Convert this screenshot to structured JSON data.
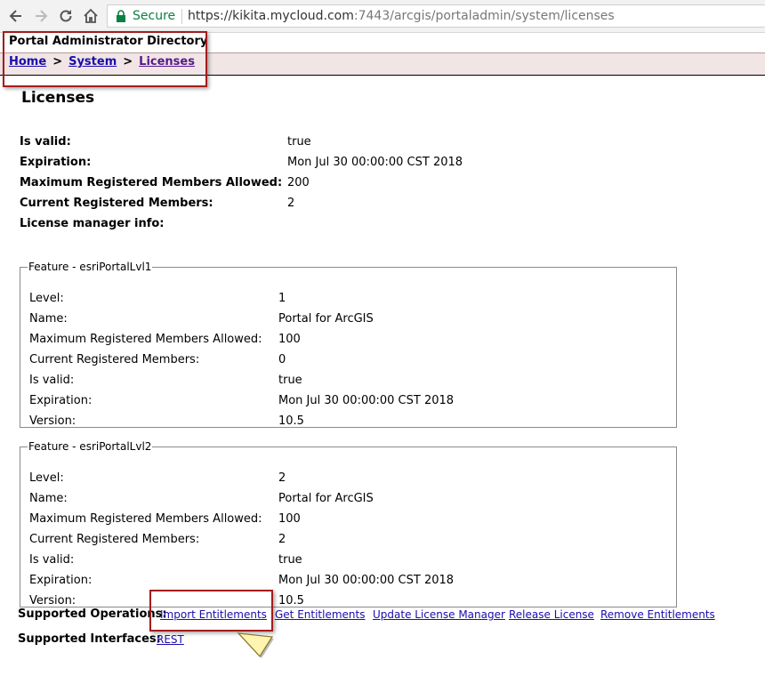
{
  "browser": {
    "secure_label": "Secure",
    "url_host": "https://kikita.mycloud.com",
    "url_rest": ":7443/arcgis/portaladmin/system/licenses"
  },
  "header": {
    "directory_title": "Portal Administrator Directory",
    "breadcrumb": [
      "Home",
      "System",
      "Licenses"
    ],
    "breadcrumb_sep": ">"
  },
  "page": {
    "title": "Licenses",
    "info": [
      {
        "label": "Is valid:",
        "value": "true"
      },
      {
        "label": "Expiration:",
        "value": "Mon Jul 30 00:00:00 CST 2018"
      },
      {
        "label": "Maximum Registered Members Allowed:",
        "value": "200"
      },
      {
        "label": "Current Registered Members:",
        "value": "2"
      },
      {
        "label": "License manager info:",
        "value": ""
      }
    ]
  },
  "features": [
    {
      "legend": "Feature - esriPortalLvl1",
      "rows": [
        {
          "label": "Level:",
          "value": "1"
        },
        {
          "label": "Name:",
          "value": "Portal for ArcGIS"
        },
        {
          "label": "Maximum Registered Members Allowed:",
          "value": "100"
        },
        {
          "label": "Current Registered Members:",
          "value": "0"
        },
        {
          "label": "Is valid:",
          "value": "true"
        },
        {
          "label": "Expiration:",
          "value": "Mon Jul 30 00:00:00 CST 2018"
        },
        {
          "label": "Version:",
          "value": "10.5"
        }
      ]
    },
    {
      "legend": "Feature - esriPortalLvl2",
      "rows": [
        {
          "label": "Level:",
          "value": "2"
        },
        {
          "label": "Name:",
          "value": "Portal for ArcGIS"
        },
        {
          "label": "Maximum Registered Members Allowed:",
          "value": "100"
        },
        {
          "label": "Current Registered Members:",
          "value": "2"
        },
        {
          "label": "Is valid:",
          "value": "true"
        },
        {
          "label": "Expiration:",
          "value": "Mon Jul 30 00:00:00 CST 2018"
        },
        {
          "label": "Version:",
          "value": "10.5"
        }
      ]
    }
  ],
  "operations": {
    "label": "Supported Operations:",
    "links": [
      "Import Entitlements",
      "Get Entitlements",
      "Update License Manager",
      "Release License",
      "Remove Entitlements"
    ]
  },
  "interfaces": {
    "label": "Supported Interfaces:",
    "links": [
      "REST"
    ]
  },
  "colors": {
    "link": "#1a0dab",
    "visited_link": "#551a8b",
    "highlight_box": "#a31c1c",
    "breadcrumb_bg": "#f1e5e5",
    "secure_green": "#0b8043"
  }
}
